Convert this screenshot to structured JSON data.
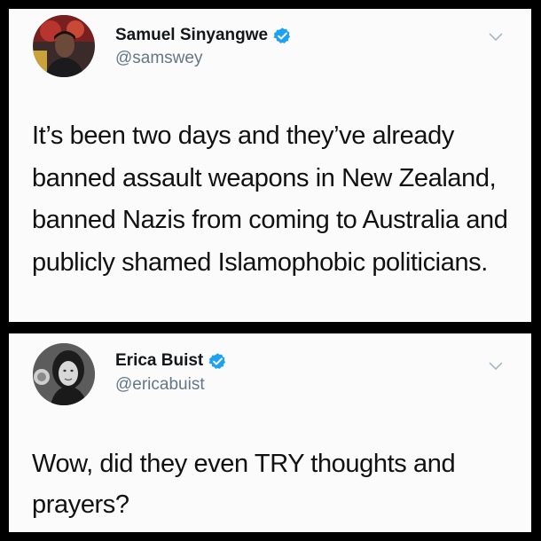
{
  "tweets": [
    {
      "display_name": "Samuel Sinyangwe",
      "handle": "@samswey",
      "verified": true,
      "text": "It’s been two days and they’ve already banned assault weapons in New Zealand, banned Nazis from coming to Australia and publicly shamed Islamophobic politicians."
    },
    {
      "display_name": "Erica Buist",
      "handle": "@ericabuist",
      "verified": true,
      "text": "Wow, did they even TRY thoughts and prayers?"
    }
  ],
  "icons": {
    "verified": "verified-badge-icon",
    "menu": "chevron-down-icon"
  },
  "colors": {
    "verified_blue": "#1da1f2",
    "handle_gray": "#657786",
    "chevron_gray": "#aab8c2",
    "background": "#000000",
    "card": "#fbfbfb"
  }
}
